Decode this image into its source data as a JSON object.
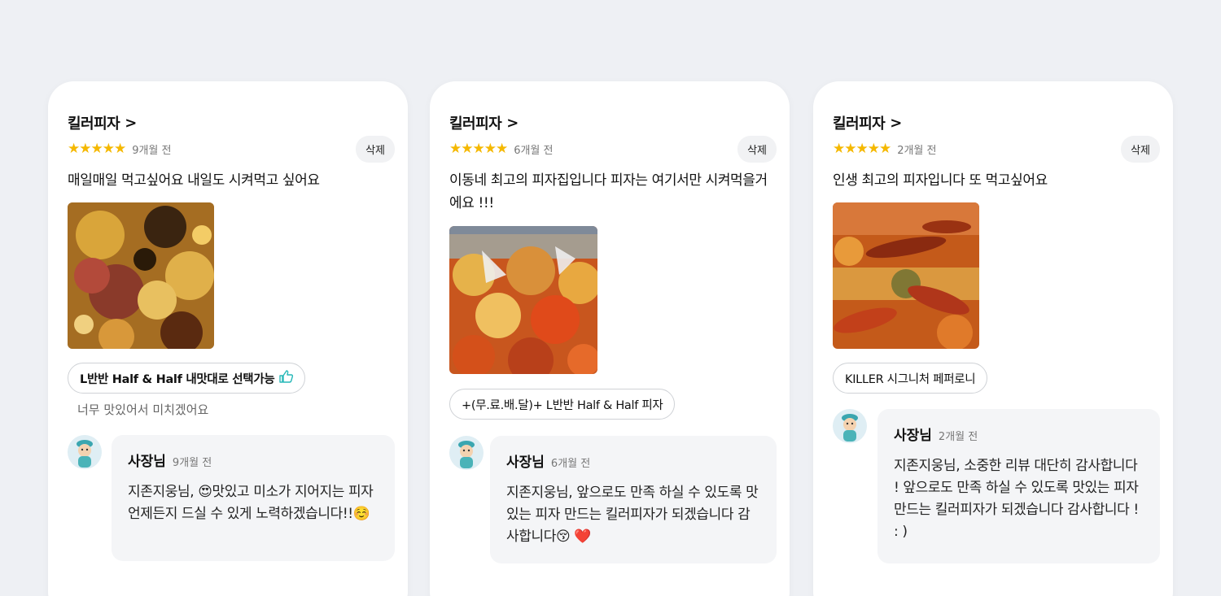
{
  "reviews": [
    {
      "shop": "킬러피자",
      "chevron": ">",
      "stars": "★★★★★",
      "time": "9개월 전",
      "delete_label": "삭제",
      "text": "매일매일 먹고싶어요 내일도 시켜먹고 싶어요",
      "menu_tag": "L반반 Half & Half 내맛대로 선택가능",
      "menu_tag_icon": "thumbs-up-icon",
      "menu_note": "너무 맛있어서 미치겠어요",
      "owner_name": "사장님",
      "owner_time": "9개월 전",
      "reply": "지존지웅님, 😍맛있고 미소가 지어지는 피자 언제든지 드실 수 있게 노력하겠습니다!!☺️"
    },
    {
      "shop": "킬러피자",
      "chevron": ">",
      "stars": "★★★★★",
      "time": "6개월 전",
      "delete_label": "삭제",
      "text": "이동네 최고의 피자집입니다 피자는 여기서만 시켜먹을거에요 !!!",
      "menu_tag": "+(무.료.배.달)+ L반반 Half & Half 피자",
      "owner_name": "사장님",
      "owner_time": "6개월 전",
      "reply": "지존지웅님,  앞으로도 만족 하실 수 있도록 맛있는 피자 만드는 킬러피자가 되겠습니다 감사합니다😚 ❤️"
    },
    {
      "shop": "킬러피자",
      "chevron": ">",
      "stars": "★★★★★",
      "time": "2개월 전",
      "delete_label": "삭제",
      "text": "인생 최고의 피자입니다 또 먹고싶어요",
      "menu_tag": "KILLER 시그니처 페퍼로니",
      "owner_name": "사장님",
      "owner_time": "2개월 전",
      "reply": "지존지웅님, 소중한 리뷰 대단히 감사합니다 ! 앞으로도 만족 하실 수 있도록 맛있는 피자 만드는 킬러피자가 되겠습니다 감사합니다 ! : )"
    }
  ],
  "colors": {
    "background": "#eef0f4",
    "star": "#f5b800",
    "thumb": "#27b8b8",
    "bubble": "#f4f5f7"
  }
}
